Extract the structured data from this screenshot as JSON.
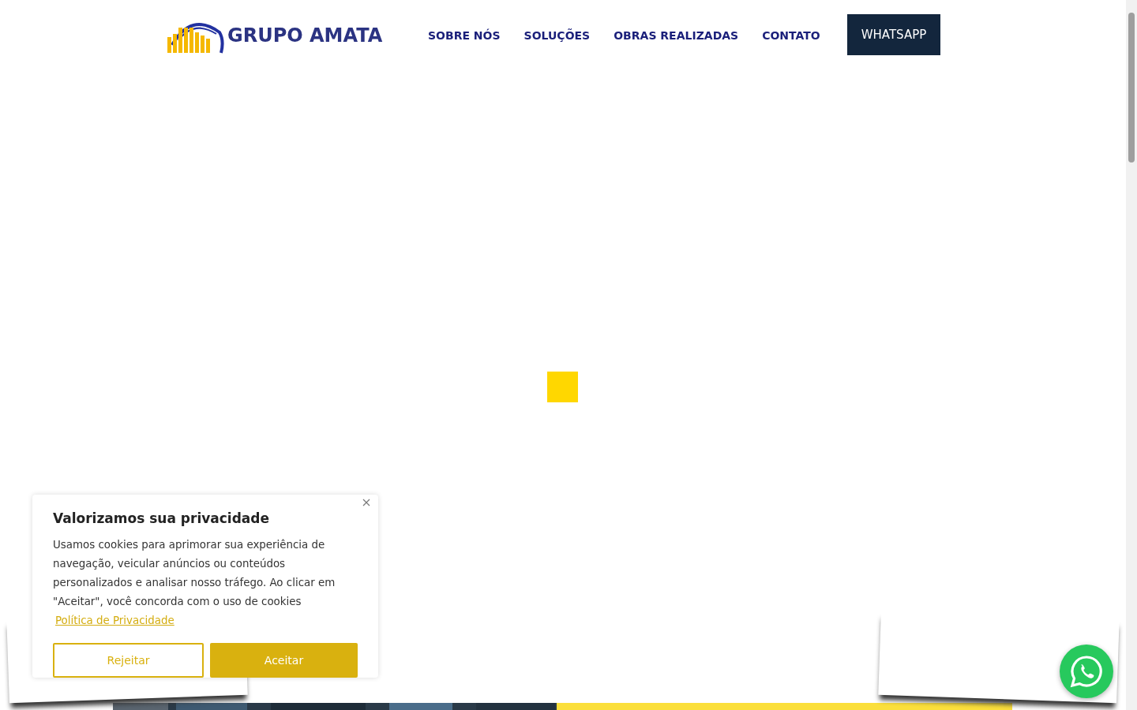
{
  "header": {
    "logo_text": "GRUPO AMATA",
    "nav": [
      {
        "label": "SOBRE NÓS"
      },
      {
        "label": "SOLUÇÕES"
      },
      {
        "label": "OBRAS REALIZADAS"
      },
      {
        "label": "CONTATO"
      }
    ],
    "cta": "WHATSAPP"
  },
  "cookie_banner": {
    "title": "Valorizamos sua privacidade",
    "message": "Usamos cookies para aprimorar sua experiência de navegação, veicular anúncios ou conteúdos personalizados e analisar nosso tráfego. Ao clicar em \"Aceitar\", você concorda com o uso de cookies",
    "link": "Política de Privacidade",
    "buttons": [
      {
        "label": "Rejeitar",
        "kind": "outline"
      },
      {
        "label": "Aceitar",
        "kind": "solid"
      }
    ]
  }
}
